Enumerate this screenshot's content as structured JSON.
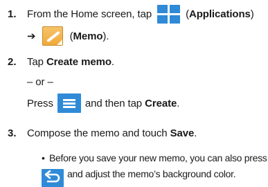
{
  "steps": [
    {
      "number": "1.",
      "line1": {
        "before": "From the Home screen, tap",
        "paren_open": "(",
        "bold": "Applications",
        "paren_close": ")"
      },
      "line2": {
        "arrow": "➔",
        "paren_open": "(",
        "bold": "Memo",
        "paren_close": ")."
      }
    },
    {
      "number": "2.",
      "line1": {
        "before": "Tap ",
        "bold": "Create memo",
        "after": "."
      },
      "or": "– or –",
      "line3": {
        "before": "Press",
        "after": "and then tap ",
        "bold": "Create",
        "end": "."
      }
    },
    {
      "number": "3.",
      "line1": {
        "before": "Compose the memo and touch ",
        "bold": "Save",
        "after": "."
      },
      "bullet": {
        "dot": "•",
        "line1": "Before you save your new memo, you can also press",
        "line2": "and adjust the memo’s background color."
      }
    }
  ],
  "icons": {
    "applications": "applications-grid-icon",
    "memo": "memo-app-icon",
    "menu": "menu-key-icon",
    "back": "back-key-icon",
    "accent": "#2f8ad7"
  }
}
